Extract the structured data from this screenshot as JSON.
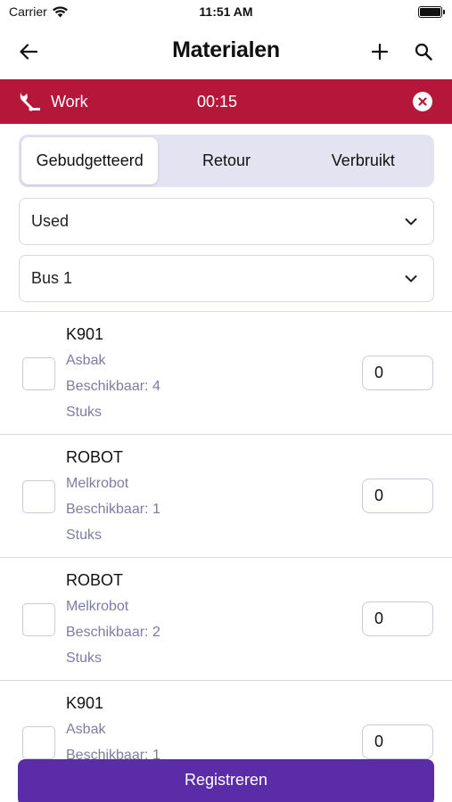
{
  "status_bar": {
    "carrier": "Carrier",
    "time": "11:51 AM"
  },
  "nav": {
    "title": "Materialen"
  },
  "work_banner": {
    "label": "Work",
    "timer": "00:15",
    "color": "#b5173a"
  },
  "segments": [
    {
      "label": "Gebudgetteerd",
      "active": true
    },
    {
      "label": "Retour",
      "active": false
    },
    {
      "label": "Verbruikt",
      "active": false
    }
  ],
  "filters": {
    "status_value": "Used",
    "location_value": "Bus 1"
  },
  "items": [
    {
      "code": "K901",
      "description": "Asbak",
      "available": "Beschikbaar: 4",
      "unit": "Stuks",
      "quantity": "0"
    },
    {
      "code": "ROBOT",
      "description": "Melkrobot",
      "available": "Beschikbaar: 1",
      "unit": "Stuks",
      "quantity": "0"
    },
    {
      "code": "ROBOT",
      "description": "Melkrobot",
      "available": "Beschikbaar: 2",
      "unit": "Stuks",
      "quantity": "0"
    },
    {
      "code": "K901",
      "description": "Asbak",
      "available": "Beschikbaar: 1",
      "unit": "",
      "quantity": "0"
    }
  ],
  "register_button": {
    "label": "Registreren",
    "color": "#5a2ca8"
  },
  "icons": [
    "wifi-icon",
    "battery-icon",
    "back-arrow-icon",
    "plus-icon",
    "search-icon",
    "wrench-icon",
    "close-circle-icon",
    "chevron-down-icon"
  ]
}
